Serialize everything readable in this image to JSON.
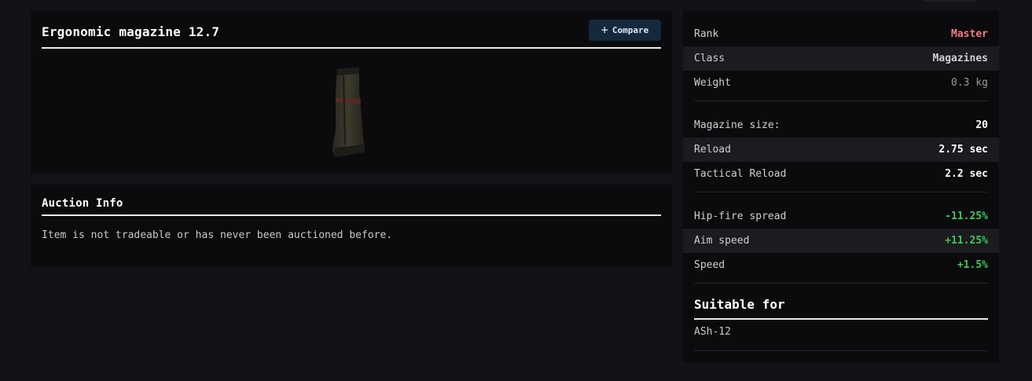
{
  "item": {
    "name": "Ergonomic magazine 12.7",
    "compare_label": "Compare",
    "compare_icon": "plus-icon"
  },
  "auction": {
    "title": "Auction Info",
    "message": "Item is not tradeable or has never been auctioned before."
  },
  "stats": {
    "basic": [
      {
        "label": "Rank",
        "value": "Master"
      },
      {
        "label": "Class",
        "value": "Magazines"
      },
      {
        "label": "Weight",
        "value": "0.3 kg"
      }
    ],
    "magazine": [
      {
        "label": "Magazine size:",
        "value": "20"
      },
      {
        "label": "Reload",
        "value": "2.75 sec"
      },
      {
        "label": "Tactical Reload",
        "value": "2.2 sec"
      }
    ],
    "modifiers": [
      {
        "label": "Hip-fire spread",
        "value": "-11.25%"
      },
      {
        "label": "Aim speed",
        "value": "+11.25%"
      },
      {
        "label": "Speed",
        "value": "+1.5%"
      }
    ]
  },
  "suitable": {
    "title": "Suitable for",
    "items": [
      "ASh-12"
    ]
  },
  "colors": {
    "background": "#131317",
    "panel": "#0b0b0e",
    "rank_master": "#f07a80",
    "positive": "#3ec856",
    "compare_button": "#14293e"
  }
}
